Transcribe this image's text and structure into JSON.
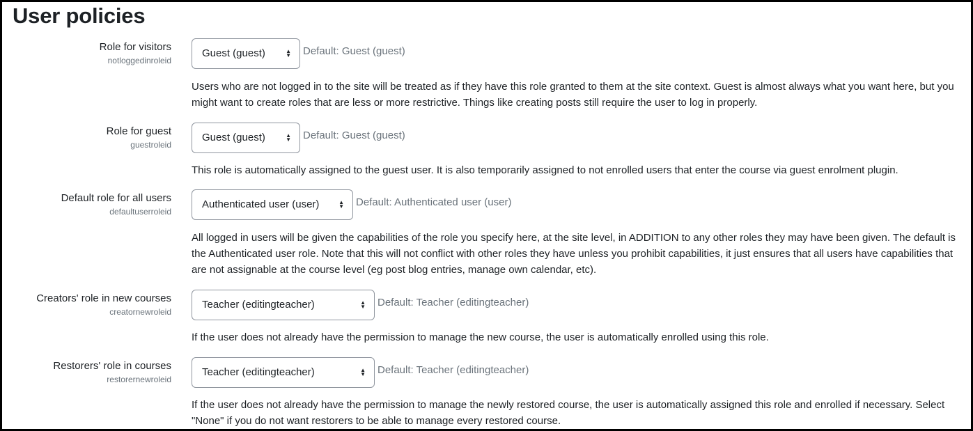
{
  "page": {
    "title": "User policies"
  },
  "settings": [
    {
      "label": "Role for visitors",
      "varname": "notloggedinroleid",
      "selected": "Guest (guest)",
      "default": "Default: Guest (guest)",
      "description": "Users who are not logged in to the site will be treated as if they have this role granted to them at the site context. Guest is almost always what you want here, but you might want to create roles that are less or more restrictive. Things like creating posts still require the user to log in properly."
    },
    {
      "label": "Role for guest",
      "varname": "guestroleid",
      "selected": "Guest (guest)",
      "default": "Default: Guest (guest)",
      "description": "This role is automatically assigned to the guest user. It is also temporarily assigned to not enrolled users that enter the course via guest enrolment plugin."
    },
    {
      "label": "Default role for all users",
      "varname": "defaultuserroleid",
      "selected": "Authenticated user (user)",
      "default": "Default: Authenticated user (user)",
      "description": "All logged in users will be given the capabilities of the role you specify here, at the site level, in ADDITION to any other roles they may have been given. The default is the Authenticated user role. Note that this will not conflict with other roles they have unless you prohibit capabilities, it just ensures that all users have capabilities that are not assignable at the course level (eg post blog entries, manage own calendar, etc)."
    },
    {
      "label": "Creators' role in new courses",
      "varname": "creatornewroleid",
      "selected": "Teacher (editingteacher)",
      "default": "Default: Teacher (editingteacher)",
      "description": "If the user does not already have the permission to manage the new course, the user is automatically enrolled using this role."
    },
    {
      "label": "Restorers' role in courses",
      "varname": "restorernewroleid",
      "selected": "Teacher (editingteacher)",
      "default": "Default: Teacher (editingteacher)",
      "description": "If the user does not already have the permission to manage the newly restored course, the user is automatically assigned this role and enrolled if necessary. Select \"None\" if you do not want restorers to be able to manage every restored course."
    }
  ],
  "icons": {
    "select_caret": "updown-caret-icon"
  }
}
